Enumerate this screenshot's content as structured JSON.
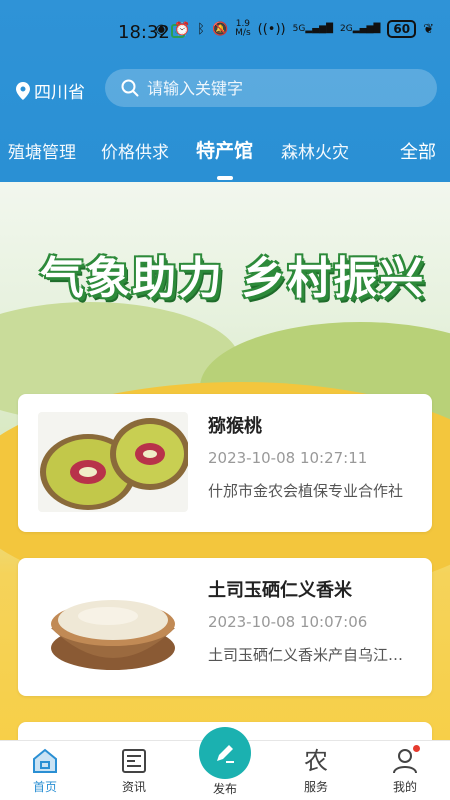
{
  "status_bar": {
    "time": "18:32",
    "net_speed_top": "1.9",
    "net_speed_unit": "M/s",
    "battery": "60",
    "signal1": "5G",
    "signal2": "2G"
  },
  "header": {
    "location": "四川省",
    "search_placeholder": "请输入关键字",
    "tabs": [
      "殖塘管理",
      "价格供求",
      "特产馆",
      "森林火灾"
    ],
    "active_tab": "特产馆",
    "all_label": "全部",
    "brand_color": "#2a90d4"
  },
  "banner": {
    "title": "气象助力 乡村振兴"
  },
  "cards": [
    {
      "title": "猕猴桃",
      "time": "2023-10-08 10:27:11",
      "desc": "什邡市金农会植保专业合作社",
      "image": "kiwi-image"
    },
    {
      "title": "土司玉硒仁义香米",
      "time": "2023-10-08 10:07:06",
      "desc": "土司玉硒仁义香米产自乌江流域",
      "image": "rice-image"
    }
  ],
  "bottom_nav": {
    "items": [
      {
        "label": "首页",
        "icon": "home-icon"
      },
      {
        "label": "资讯",
        "icon": "news-icon"
      },
      {
        "label": "发布",
        "icon": "pencil-icon"
      },
      {
        "label": "服务",
        "icon": "agri-icon"
      },
      {
        "label": "我的",
        "icon": "user-icon"
      }
    ],
    "service_glyph": "农",
    "active_color": "#2a8fd3",
    "publish_color": "#1bb1b0"
  }
}
